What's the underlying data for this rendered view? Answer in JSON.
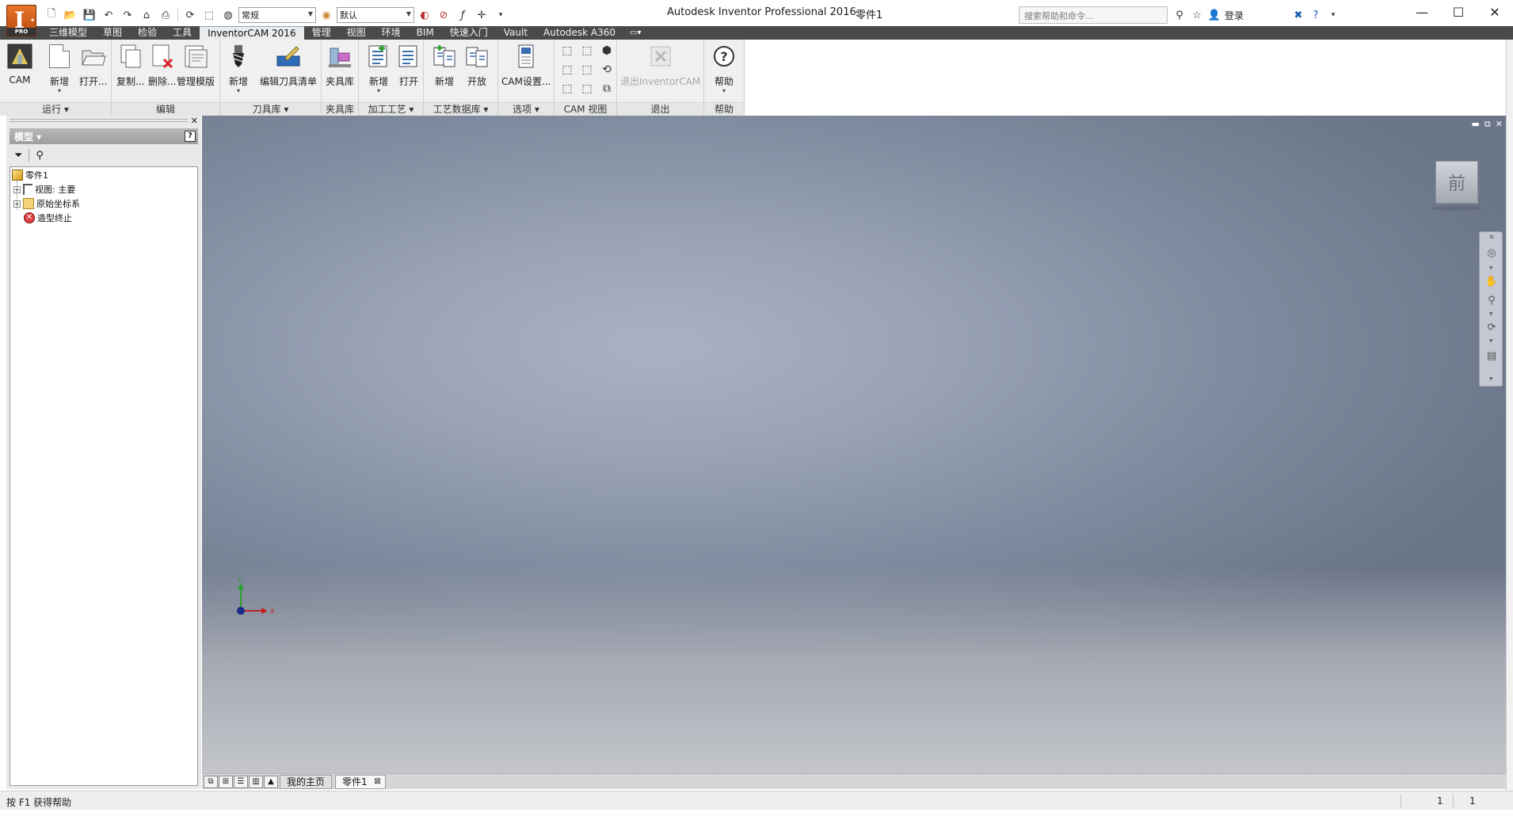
{
  "app": {
    "logo_letter": "I",
    "logo_badge": "PRO",
    "window_title": "Autodesk Inventor Professional 2016",
    "document_title": "零件1"
  },
  "qat": {
    "appearance_value": "常规",
    "material_value": "默认"
  },
  "help": {
    "search_placeholder": "搜索帮助和命令...",
    "sign_in": "登录"
  },
  "window_controls": [
    "—",
    "☐",
    "✕"
  ],
  "ribbon_tabs": [
    {
      "label": "三维模型",
      "active": false
    },
    {
      "label": "草图",
      "active": false
    },
    {
      "label": "检验",
      "active": false
    },
    {
      "label": "工具",
      "active": false
    },
    {
      "label": "InventorCAM 2016",
      "active": true
    },
    {
      "label": "管理",
      "active": false
    },
    {
      "label": "视图",
      "active": false
    },
    {
      "label": "环境",
      "active": false
    },
    {
      "label": "BIM",
      "active": false
    },
    {
      "label": "快速入门",
      "active": false
    },
    {
      "label": "Vault",
      "active": false
    },
    {
      "label": "Autodesk A360",
      "active": false
    }
  ],
  "ribbon": {
    "groups": {
      "run": "运行 ▾",
      "edit": "编辑",
      "tool_library": "刀具库 ▾",
      "fixture": "夹具库",
      "process": "加工工艺 ▾",
      "process_db": "工艺数据库 ▾",
      "options": "选项 ▾",
      "cam_view": "CAM 视图",
      "exit": "退出",
      "help": "帮助"
    },
    "buttons": {
      "cam": "CAM",
      "new": "新增",
      "open": "打开...",
      "copy": "复制...",
      "delete": "删除...",
      "manage_templates": "管理模版",
      "tool_new": "新增",
      "edit_tool_list": "编辑刀具清单",
      "fixture_lib": "夹具库",
      "process_new": "新增",
      "process_open": "打开",
      "db_new": "新增",
      "db_open": "开放",
      "cam_settings": "CAM设置...",
      "exit_cam": "退出InventorCAM",
      "help": "帮助"
    }
  },
  "browser": {
    "title": "模型 ▾",
    "help_icon": "?",
    "tree": [
      {
        "label": "零件1",
        "icon": "part-icon"
      },
      {
        "label": "视图: 主要",
        "icon": "view-rep-icon"
      },
      {
        "label": "原始坐标系",
        "icon": "folder-icon"
      },
      {
        "label": "造型终止",
        "icon": "end-of-part-icon"
      }
    ]
  },
  "viewport": {
    "viewcube_face": "前",
    "axis_x": "X",
    "axis_y": "Y"
  },
  "doc_tabs": [
    {
      "label": "我的主页",
      "active": false
    },
    {
      "label": "零件1",
      "active": true
    }
  ],
  "status": {
    "message": "按 F1 获得帮助",
    "count1": "1",
    "count2": "1"
  }
}
